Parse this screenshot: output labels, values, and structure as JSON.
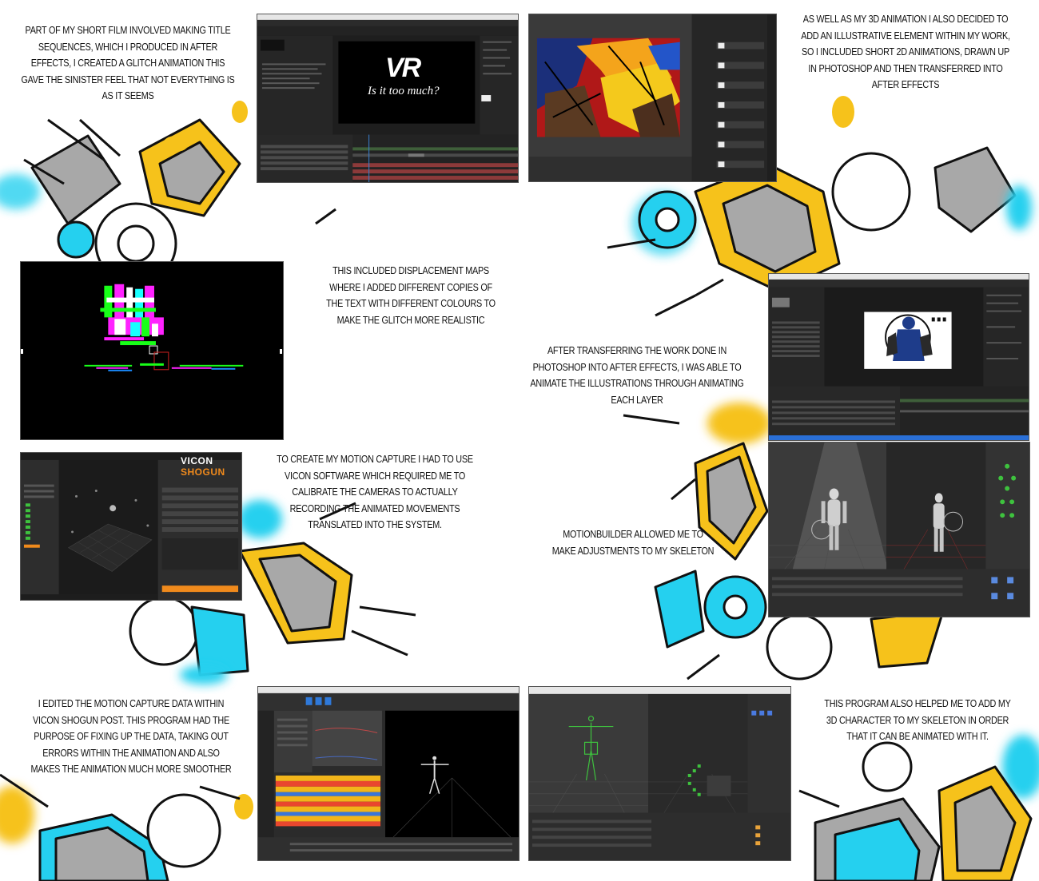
{
  "captions": {
    "title_sequences": "PART OF MY SHORT FILM INVOLVED MAKING TITLE SEQUENCES, WHICH I PRODUCED IN AFTER EFFECTS, I CREATED A GLITCH ANIMATION THIS GAVE THE SINISTER FEEL THAT NOT EVERYTHING IS AS IT SEEMS",
    "illustrative": "AS WELL AS MY 3D ANIMATION I ALSO DECIDED TO ADD AN ILLUSTRATIVE ELEMENT WITHIN MY WORK, SO I INCLUDED SHORT 2D ANIMATIONS, DRAWN UP IN PHOTOSHOP AND THEN TRANSFERRED INTO AFTER EFFECTS",
    "displacement": "THIS INCLUDED DISPLACEMENT MAPS WHERE I ADDED DIFFERENT COPIES OF THE TEXT WITH DIFFERENT COLOURS TO MAKE THE GLITCH MORE REALISTIC",
    "transferring": "AFTER TRANSFERRING THE WORK DONE IN PHOTOSHOP INTO AFTER EFFECTS, I WAS ABLE TO ANIMATE THE ILLUSTRATIONS THROUGH ANIMATING EACH LAYER",
    "motion_capture": "TO CREATE MY MOTION CAPTURE I HAD TO USE VICON SOFTWARE WHICH REQUIRED ME TO CALIBRATE THE CAMERAS TO ACTUALLY RECORDING THE ANIMATED MOVEMENTS TRANSLATED INTO THE SYSTEM.",
    "motionbuilder": "MOTIONBUILDER ALLOWED ME TO MAKE ADJUSTMENTS TO MY SKELETON",
    "shogun_post": "I EDITED THE MOTION CAPTURE DATA WITHIN VICON SHOGUN POST. THIS PROGRAM HAD THE PURPOSE OF FIXING UP THE DATA, TAKING OUT ERRORS WITHIN THE ANIMATION AND ALSO MAKES THE ANIMATION MUCH MORE SMOOTHER",
    "character": "THIS PROGRAM ALSO HELPED ME TO ADD MY 3D CHARACTER TO MY SKELETON IN ORDER THAT IT CAN BE ANIMATED WITH IT."
  },
  "screens": {
    "after_effects_title": {
      "title": "VR",
      "subtitle": "Is it too much?"
    },
    "vicon": {
      "logo_main": "VICON",
      "logo_sub": "SHOGUN"
    }
  },
  "colors": {
    "yellow": "#f6c21b",
    "cyan": "#25d0ef",
    "grey": "#a8a8a8",
    "ink": "#111111",
    "ui_dark": "#262626",
    "ui_panel": "#323232",
    "accent_orange": "#f08a1c"
  }
}
